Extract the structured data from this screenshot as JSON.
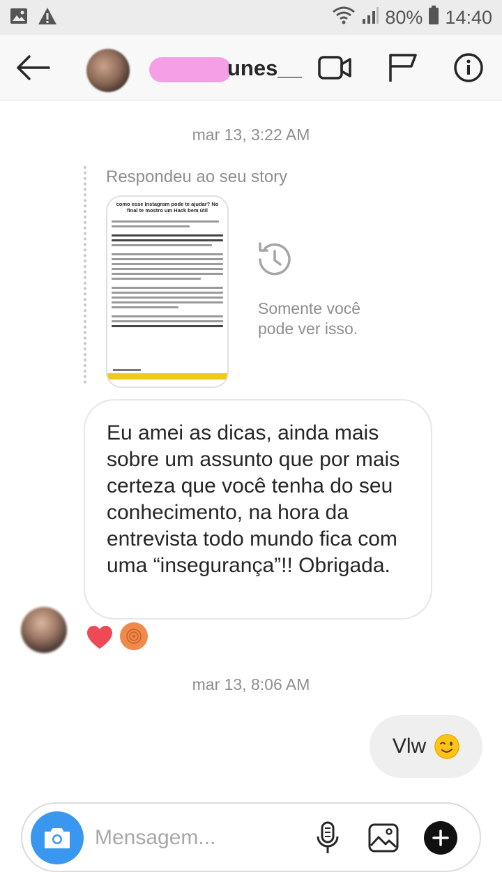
{
  "status_bar": {
    "battery": "80%",
    "time": "14:40",
    "icons": [
      "image-icon",
      "warning-icon",
      "wifi-icon",
      "signal-icon",
      "battery-icon"
    ]
  },
  "header": {
    "username": "unes__",
    "icons": [
      "back-arrow-icon",
      "video-call-icon",
      "flag-icon",
      "info-icon"
    ]
  },
  "chat": {
    "timestamp_1": "mar 13, 3:22 AM",
    "story_reply": {
      "label": "Respondeu ao seu story",
      "story_title": "como esse Instagram pode te ajudar? No final te mostro um Hack bem útil",
      "visibility_note": "Somente você pode ver isso."
    },
    "incoming_message": "Eu amei as dicas, ainda mais sobre um assunto que por mais certeza que você tenha do seu conhecimento, na hora da entrevista todo mundo fica com uma “insegurança”!! Obrigada.",
    "reaction": "heart",
    "timestamp_2": "mar 13, 8:06 AM",
    "outgoing_message": "Vlw",
    "outgoing_emoji": "winking-face"
  },
  "composer": {
    "placeholder": "Mensagem...",
    "icons": [
      "camera-icon",
      "microphone-icon",
      "gallery-icon",
      "plus-icon"
    ]
  },
  "colors": {
    "camera_button": "#3a97f0",
    "reaction_heart": "#ed4956",
    "username_blur": "#f59fe6"
  }
}
